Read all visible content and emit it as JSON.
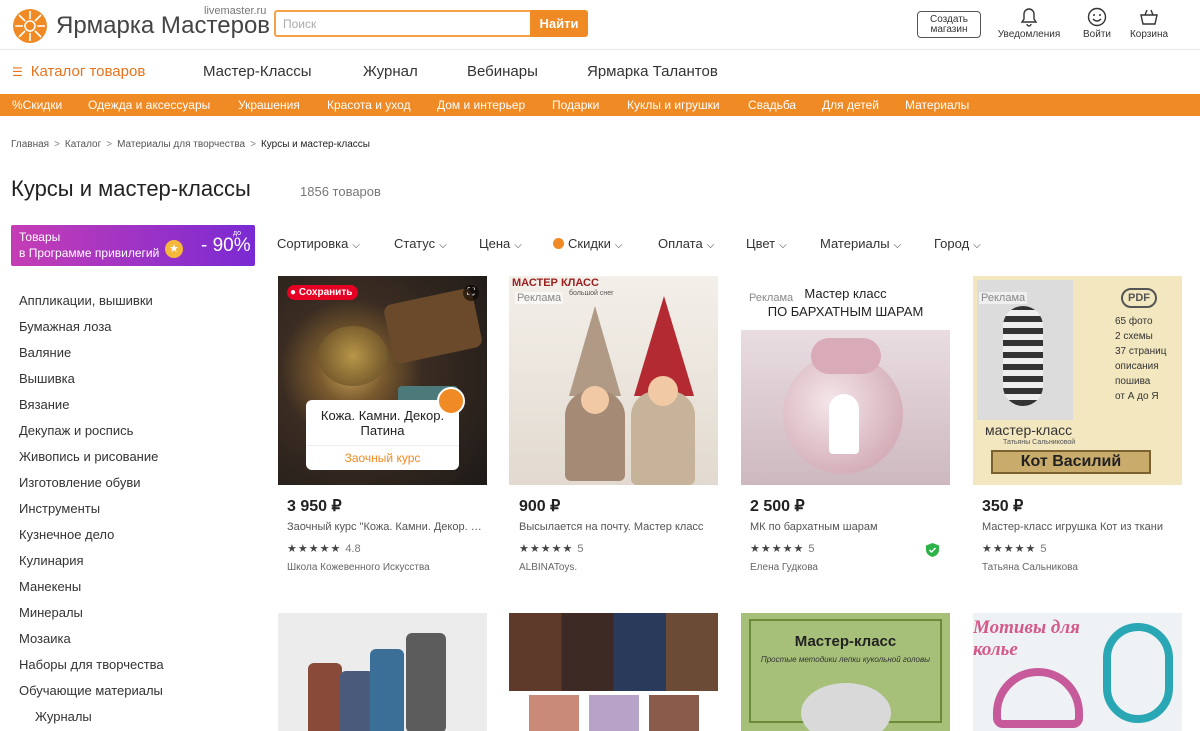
{
  "header": {
    "logo_text": "Ярмарка Мастеров",
    "logo_domain": "livemaster.ru",
    "search_placeholder": "Поиск",
    "search_button": "Найти",
    "create_shop_line1": "Создать",
    "create_shop_line2": "магазин",
    "notifications": "Уведомления",
    "login": "Войти",
    "cart": "Корзина"
  },
  "main_nav": {
    "catalog": "Каталог товаров",
    "items": [
      "Мастер-Классы",
      "Журнал",
      "Вебинары",
      "Ярмарка Талантов"
    ]
  },
  "categories": [
    "%Скидки",
    "Одежда и аксессуары",
    "Украшения",
    "Красота и уход",
    "Дом и интерьер",
    "Подарки",
    "Куклы и игрушки",
    "Свадьба",
    "Для детей",
    "Материалы"
  ],
  "breadcrumb": [
    "Главная",
    "Каталог",
    "Материалы для творчества",
    "Курсы и мастер-классы"
  ],
  "page": {
    "title": "Курсы и мастер-классы",
    "count": "1856 товаров"
  },
  "promo": {
    "line1": "Товары",
    "line2": "в Программе привилегий",
    "up_to": "до",
    "percent": "- 90%"
  },
  "filters": [
    "Сортировка",
    "Статус",
    "Цена",
    "Скидки",
    "Оплата",
    "Цвет",
    "Материалы",
    "Город"
  ],
  "sidebar": [
    "Аппликации, вышивки",
    "Бумажная лоза",
    "Валяние",
    "Вышивка",
    "Вязание",
    "Декупаж и роспись",
    "Живопись и рисование",
    "Изготовление обуви",
    "Инструменты",
    "Кузнечное дело",
    "Кулинария",
    "Манекены",
    "Минералы",
    "Мозаика",
    "Наборы для творчества",
    "Обучающие материалы",
    "Журналы"
  ],
  "products": [
    {
      "price": "3 950 ₽",
      "desc": "Заочный курс \"Кожа. Камни. Декор. Патина\"",
      "rating": "4.8",
      "seller": "Школа Кожевенного Искусства",
      "ad": "Реклама",
      "save": "Сохранить",
      "overlay_title": "Кожа. Камни. Декор. Патина",
      "overlay_sub": "Заочный курс",
      "verified": false
    },
    {
      "price": "900 ₽",
      "desc": "Высылается на почту. Мастер класс",
      "rating": "5",
      "seller": "ALBINAToys.",
      "ad": "Реклама",
      "img_text": "МАСТЕР КЛАСС",
      "img_sub": "большой снег",
      "verified": false
    },
    {
      "price": "2 500 ₽",
      "desc": "МК по бархатным шарам",
      "rating": "5",
      "seller": "Елена Гудкова",
      "ad": "Реклама",
      "img_text1": "Мастер класс",
      "img_text2": "ПО БАРХАТНЫМ ШАРАМ",
      "verified": true
    },
    {
      "price": "350 ₽",
      "desc": "Мастер-класс игрушка Кот из ткани",
      "rating": "5",
      "seller": "Татьяна Сальникова",
      "ad": "Реклама",
      "pdf": "PDF",
      "feat1": "65 фото",
      "feat2": "2 схемы",
      "feat3": "37 страниц",
      "feat4": "описания",
      "feat5": "пошива",
      "feat6": "от А до Я",
      "mk": "мастер-класс",
      "author": "Татьяны Сальниковой",
      "name": "Кот Василий",
      "verified": false
    }
  ],
  "second_row": [
    {
      "img_title": "",
      "img_sub": ""
    },
    {
      "img_title": "",
      "img_sub": ""
    },
    {
      "img_title": "Мастер-класс",
      "img_sub": "Простые методики лепки кукольной головы"
    },
    {
      "img_title": "Мотивы для колье",
      "img_sub": ""
    }
  ],
  "colors": {
    "accent": "#f08a24",
    "catalog": "#e8731c",
    "promo_from": "#c53db5",
    "promo_to": "#7a2ad3",
    "verified": "#2db34a"
  }
}
